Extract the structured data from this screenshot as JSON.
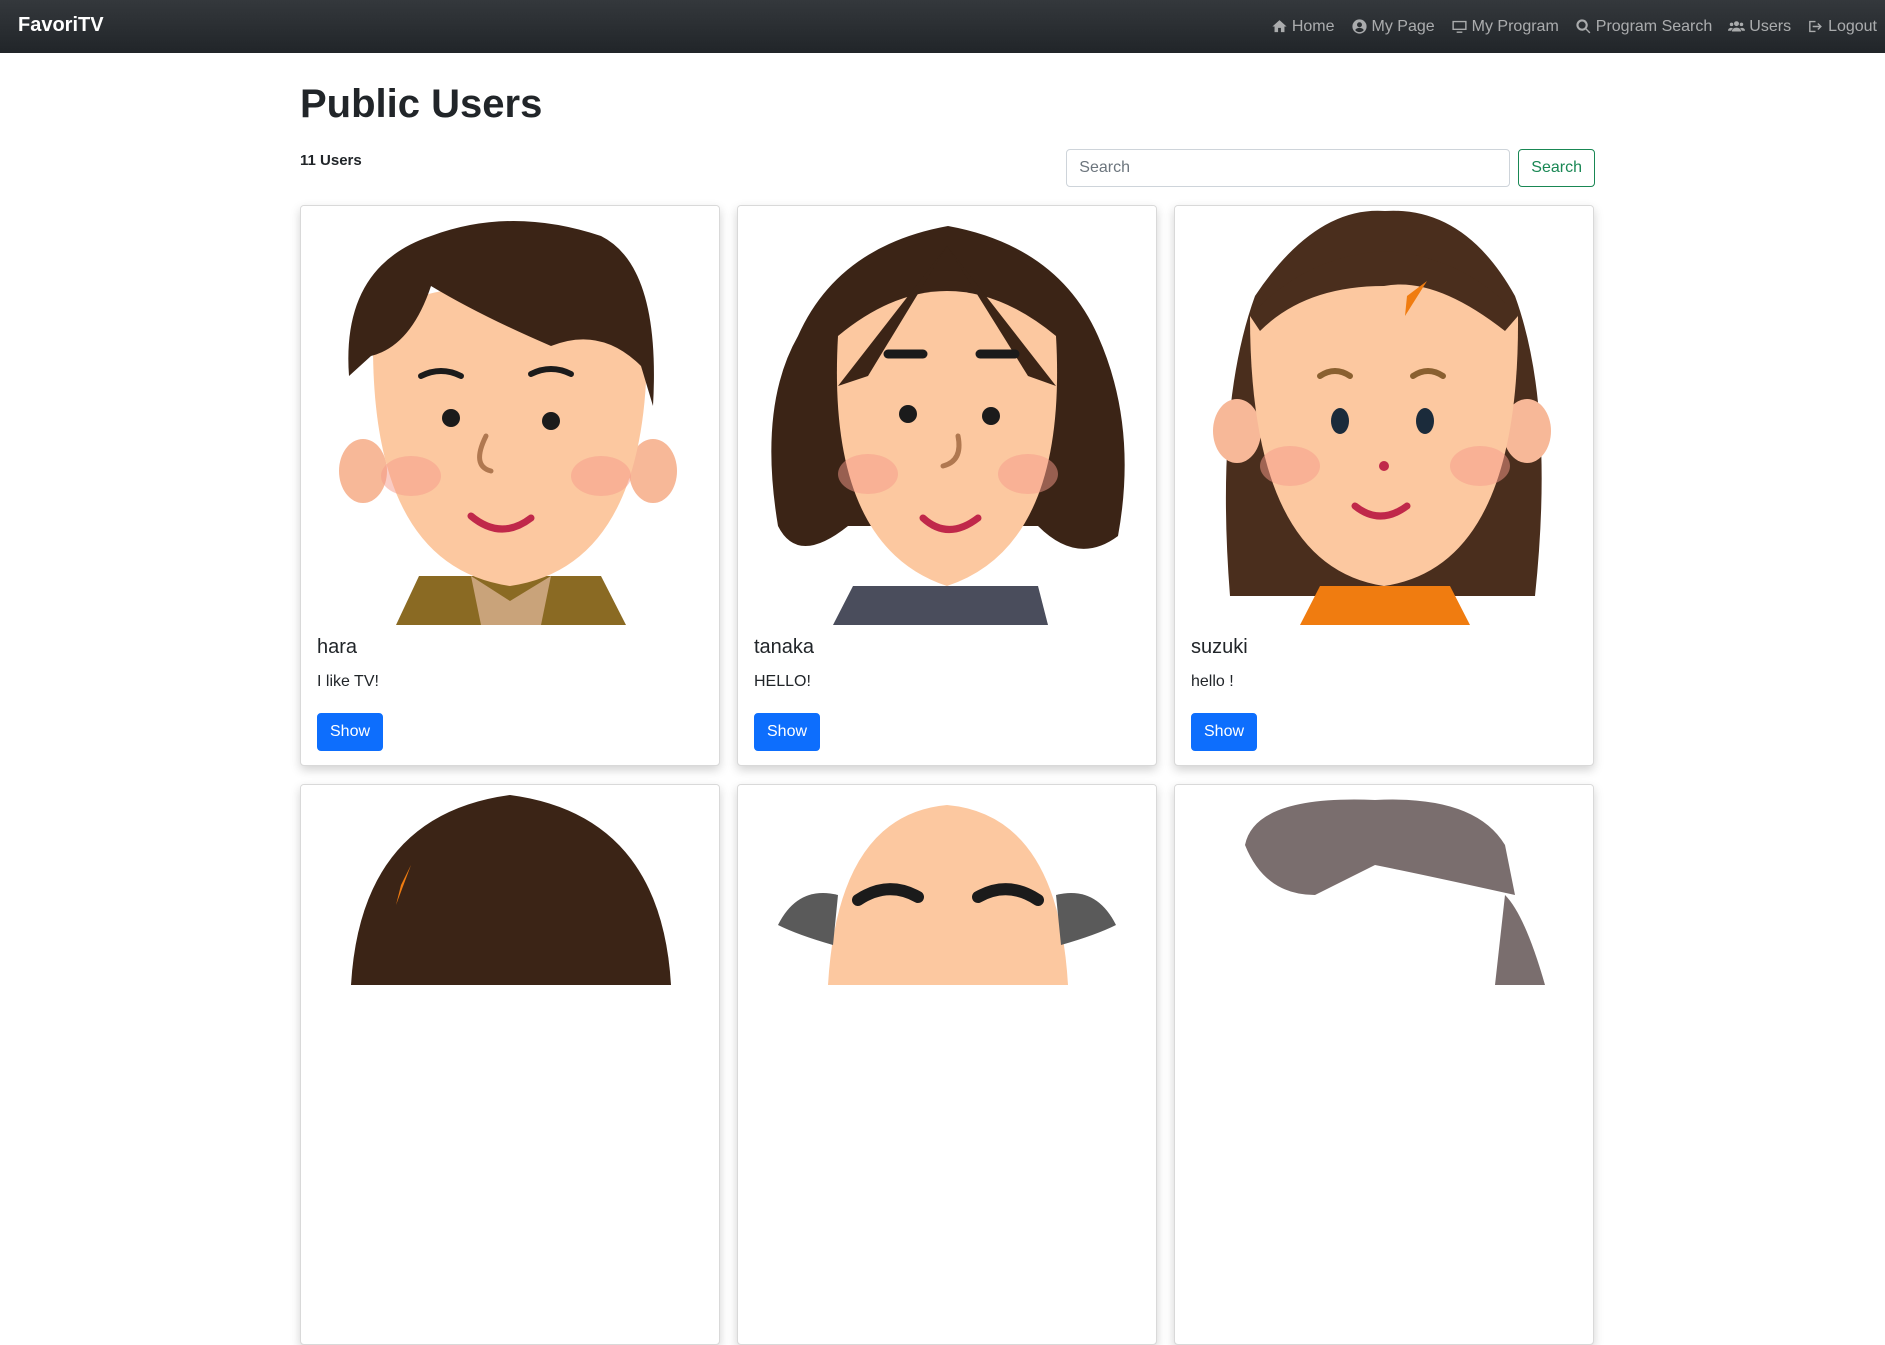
{
  "navbar": {
    "brand": "FavoriTV",
    "links": [
      {
        "label": "Home",
        "icon": "home-icon"
      },
      {
        "label": "My Page",
        "icon": "user-circle-icon"
      },
      {
        "label": "My Program",
        "icon": "monitor-icon"
      },
      {
        "label": "Program Search",
        "icon": "search-icon"
      },
      {
        "label": "Users",
        "icon": "users-icon"
      },
      {
        "label": "Logout",
        "icon": "logout-icon"
      }
    ]
  },
  "page": {
    "title": "Public Users",
    "user_count": "11 Users"
  },
  "search": {
    "placeholder": "Search",
    "button_label": "Search"
  },
  "users": [
    {
      "name": "hara",
      "bio": "I like TV!",
      "button": "Show",
      "avatar": "man-short-hair-avatar"
    },
    {
      "name": "tanaka",
      "bio": "HELLO!",
      "button": "Show",
      "avatar": "man-wavy-hair-avatar"
    },
    {
      "name": "suzuki",
      "bio": "hello !",
      "button": "Show",
      "avatar": "girl-long-hair-avatar"
    },
    {
      "name": "",
      "bio": "",
      "button": "",
      "avatar": "brown-hair-avatar"
    },
    {
      "name": "",
      "bio": "",
      "button": "",
      "avatar": "bald-man-avatar"
    },
    {
      "name": "",
      "bio": "",
      "button": "",
      "avatar": "gray-hair-avatar"
    }
  ],
  "colors": {
    "navbar_bg": "#212529",
    "primary": "#0d6efd",
    "success": "#198754"
  }
}
